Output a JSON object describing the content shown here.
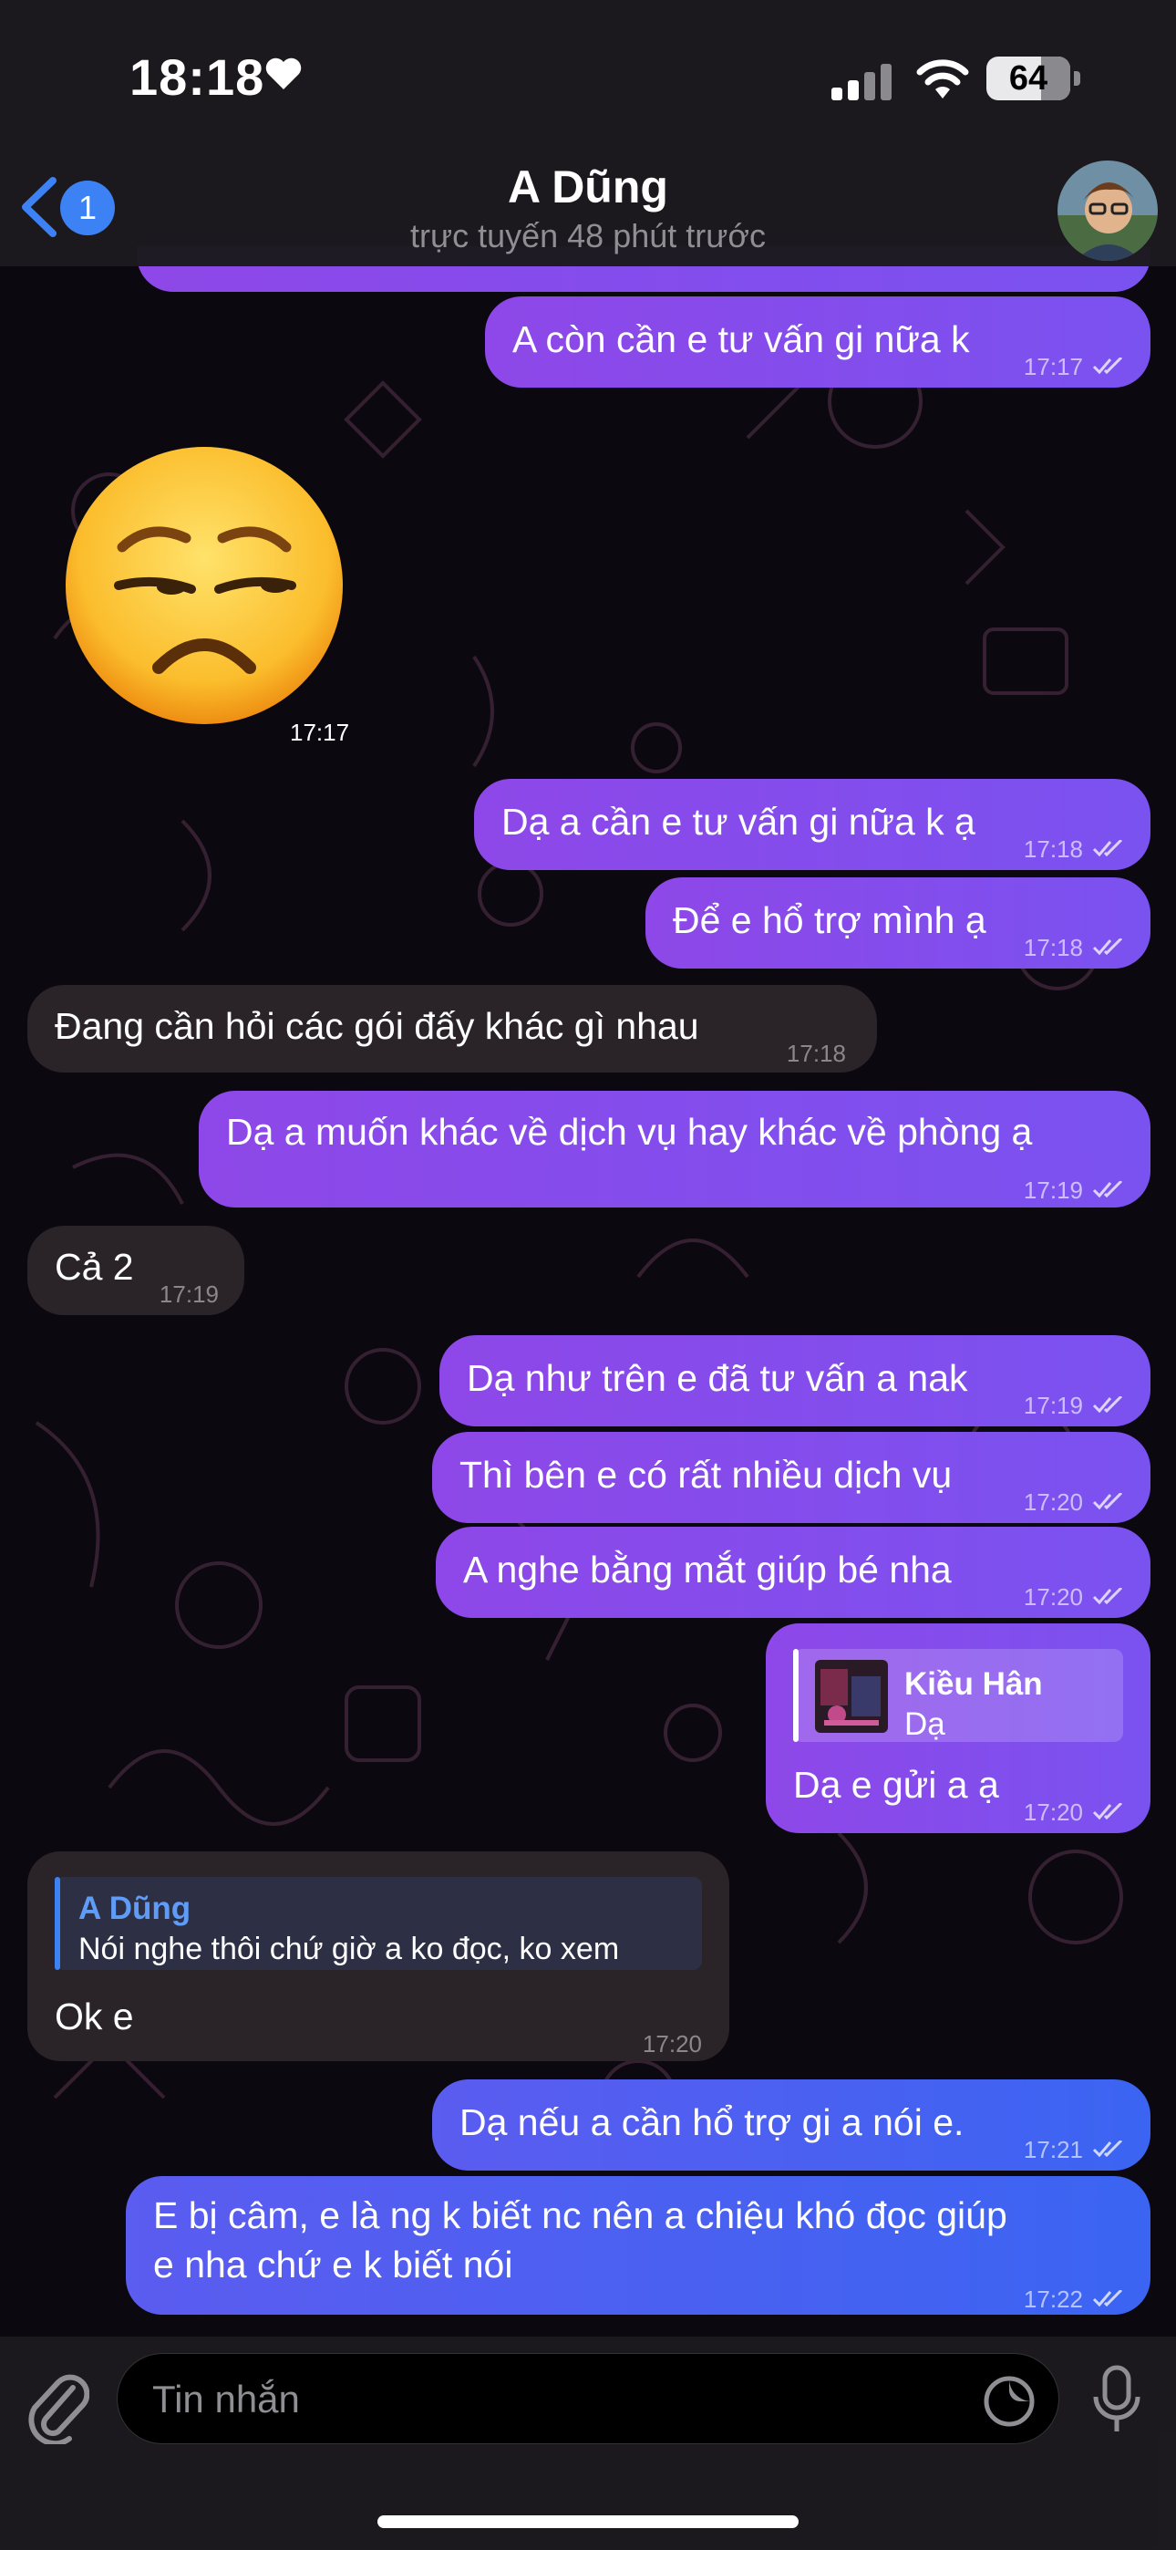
{
  "status_bar": {
    "time": "18:18",
    "battery": "64"
  },
  "header": {
    "back_badge": "1",
    "title": "A Dũng",
    "subtitle": "trực tuyến 48 phút trước"
  },
  "messages": [
    {
      "text": "A còn cần e tư vấn gi nữa k",
      "time": "17:17"
    },
    {
      "emoji": "😒",
      "time": "17:17"
    },
    {
      "text": "Dạ a cần e tư vấn gi nữa k ạ",
      "time": "17:18"
    },
    {
      "text": "Để e hổ trợ mình ạ",
      "time": "17:18"
    },
    {
      "text": "Đang cần hỏi các gói đấy khác gì nhau",
      "time": "17:18"
    },
    {
      "text": "Dạ a muốn khác về dịch vụ hay khác về phòng ạ",
      "time": "17:19"
    },
    {
      "text": "Cả 2",
      "time": "17:19"
    },
    {
      "text": "Dạ như trên e đã tư vấn a nak",
      "time": "17:19"
    },
    {
      "text": "Thì bên e có rất nhiều dịch vụ",
      "time": "17:20"
    },
    {
      "text": "A nghe bằng mắt giúp bé nha",
      "time": "17:20"
    },
    {
      "reply_name": "Kiều Hân",
      "reply_text": "Dạ",
      "text": "Dạ e gửi a ạ",
      "time": "17:20"
    },
    {
      "reply_name": "A Dũng",
      "reply_text": "Nói nghe thôi chứ giờ a ko đọc, ko xem",
      "text": "Ok e",
      "time": "17:20"
    },
    {
      "text": "Dạ nếu a cần hổ trợ gi a nói e.",
      "time": "17:21"
    },
    {
      "line1": "E bị câm, e là ng k biết nc nên a chiệu khó đọc giúp",
      "line2": "e nha chứ e k biết nói",
      "time": "17:22"
    }
  ],
  "input": {
    "placeholder": "Tin nhắn"
  },
  "colors": {
    "accent_blue": "#3d82f5",
    "outgoing": "#8447ea",
    "incoming": "#2a2428"
  }
}
